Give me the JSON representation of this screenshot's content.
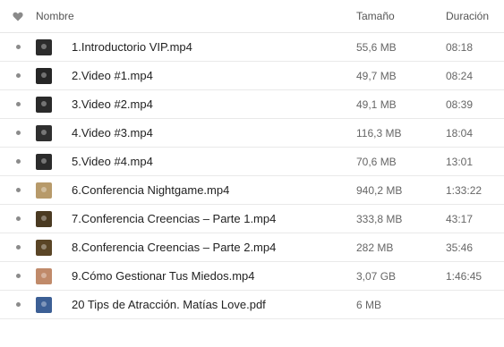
{
  "header": {
    "name_label": "Nombre",
    "size_label": "Tamaño",
    "duration_label": "Duración"
  },
  "files": [
    {
      "name": "1.Introductorio VIP.mp4",
      "size": "55,6 MB",
      "duration": "08:18",
      "thumb_color": "#2c2c2c"
    },
    {
      "name": "2.Video #1.mp4",
      "size": "49,7 MB",
      "duration": "08:24",
      "thumb_color": "#262626"
    },
    {
      "name": "3.Video #2.mp4",
      "size": "49,1 MB",
      "duration": "08:39",
      "thumb_color": "#2a2a2a"
    },
    {
      "name": "4.Video #3.mp4",
      "size": "116,3 MB",
      "duration": "18:04",
      "thumb_color": "#2f2f2f"
    },
    {
      "name": "5.Video #4.mp4",
      "size": "70,6 MB",
      "duration": "13:01",
      "thumb_color": "#2b2b2b"
    },
    {
      "name": "6.Conferencia Nightgame.mp4",
      "size": "940,2 MB",
      "duration": "1:33:22",
      "thumb_color": "#b79a6a"
    },
    {
      "name": "7.Conferencia Creencias – Parte 1.mp4",
      "size": "333,8 MB",
      "duration": "43:17",
      "thumb_color": "#4a3a22"
    },
    {
      "name": "8.Conferencia Creencias – Parte 2.mp4",
      "size": "282 MB",
      "duration": "35:46",
      "thumb_color": "#5a4526"
    },
    {
      "name": "9.Cómo Gestionar Tus Miedos.mp4",
      "size": "3,07 GB",
      "duration": "1:46:45",
      "thumb_color": "#c08a6a"
    },
    {
      "name": "20 Tips de Atracción. Matías Love.pdf",
      "size": "6 MB",
      "duration": "",
      "thumb_color": "#3c5f95"
    }
  ]
}
